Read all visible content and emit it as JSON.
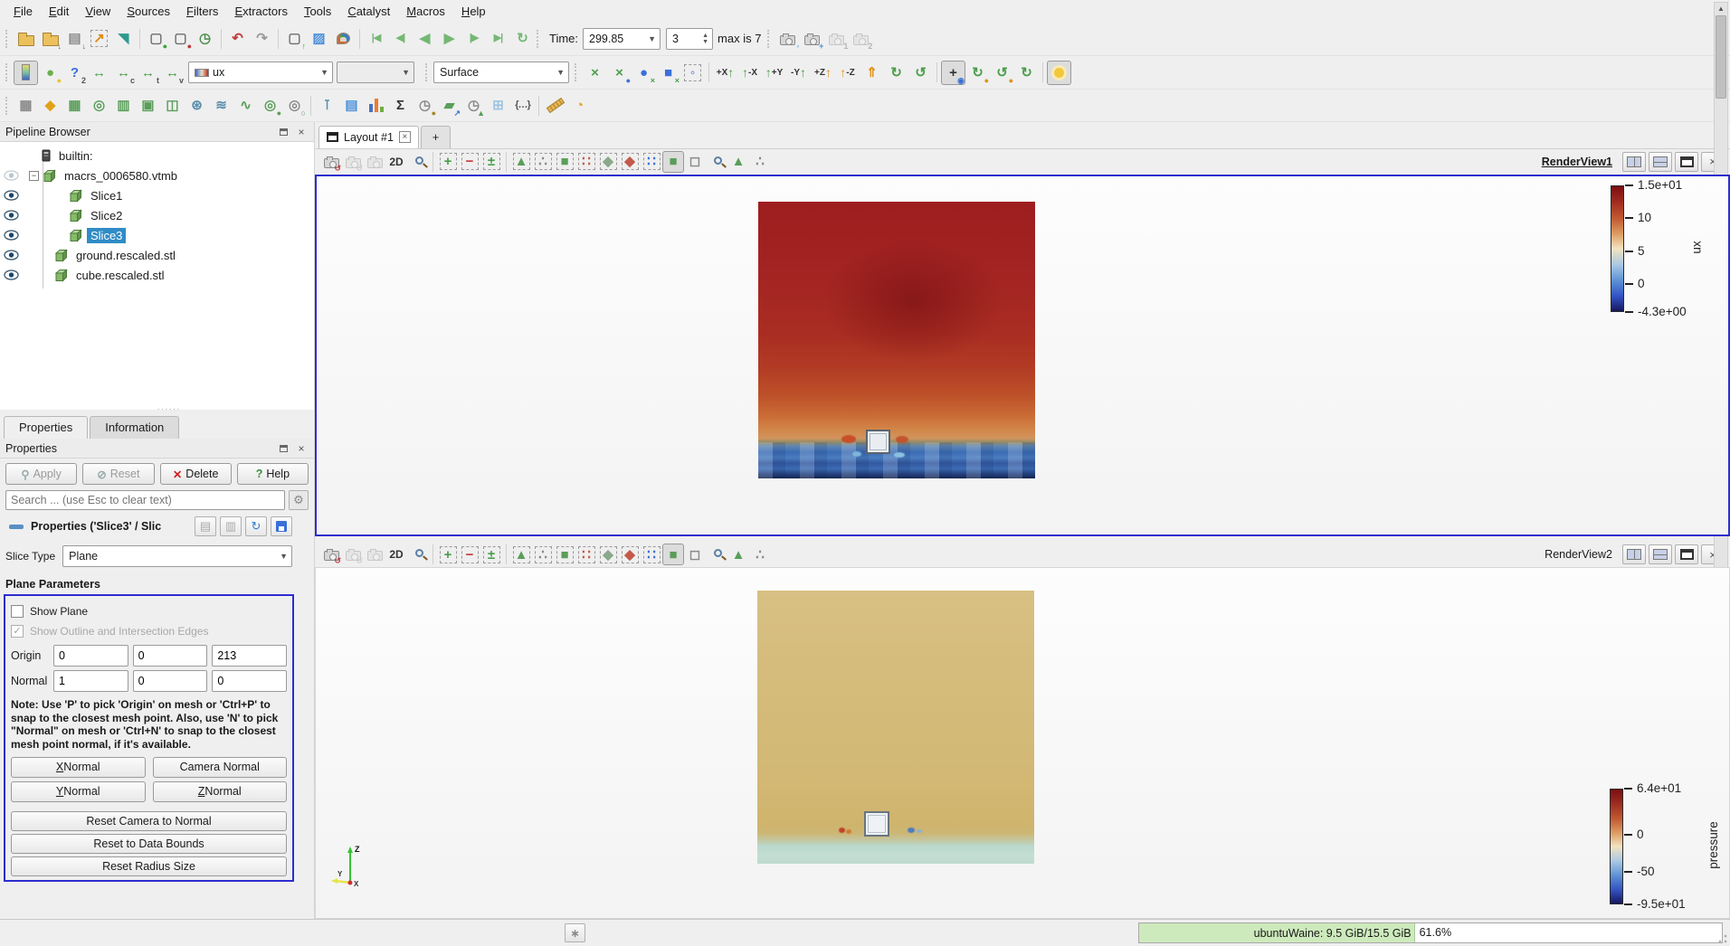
{
  "menu_bar": {
    "items": [
      "File",
      "Edit",
      "View",
      "Sources",
      "Filters",
      "Extractors",
      "Tools",
      "Catalyst",
      "Macros",
      "Help"
    ]
  },
  "toolbar_main": {
    "icons": [
      {
        "n": "open-file-icon",
        "k": "folder"
      },
      {
        "n": "save-data-icon",
        "k": "folder",
        "b": "↓",
        "bc": "#2e8b2e"
      },
      {
        "n": "save-state-icon",
        "g": "▤",
        "c": "#8a8a8a",
        "b": "↓",
        "bc": "#2e8b2e"
      },
      {
        "n": "auto-apply-icon",
        "g": "↗",
        "c": "#e08a1a",
        "f": 1
      },
      {
        "n": "test-tube-icon",
        "g": "◥",
        "c": "#2e9b8f"
      },
      {
        "sep": 1
      },
      {
        "n": "server-connect-icon",
        "g": "▢",
        "c": "#707070",
        "b": "●",
        "bc": "#3aa63a"
      },
      {
        "n": "server-disconnect-icon",
        "g": "▢",
        "c": "#707070",
        "b": "●",
        "bc": "#c23a3a"
      },
      {
        "n": "reset-session-icon",
        "g": "◷",
        "c": "#4a8f4a"
      },
      {
        "sep": 1
      },
      {
        "n": "undo-icon",
        "g": "↶",
        "c": "#c23a3a"
      },
      {
        "n": "redo-icon",
        "g": "↷",
        "c": "#9a9a9a"
      },
      {
        "sep": 1
      },
      {
        "n": "server-upload-icon",
        "g": "▢",
        "c": "#707070",
        "b": "↑",
        "bc": "#3aa63a"
      },
      {
        "n": "selection-save-icon",
        "g": "▨",
        "c": "#4a90d9"
      },
      {
        "n": "color-palette-icon",
        "k": "palette"
      },
      {
        "sep": 1
      },
      {
        "n": "first-frame-icon",
        "g": "|◀",
        "sm": 1,
        "c": "#74b874"
      },
      {
        "n": "previous-frame-icon",
        "g": "◀|",
        "sm": 1,
        "c": "#74b874"
      },
      {
        "n": "play-reverse-icon",
        "g": "◀",
        "c": "#74b874"
      },
      {
        "n": "play-icon",
        "g": "▶",
        "c": "#74b874"
      },
      {
        "n": "next-frame-icon",
        "g": "|▶",
        "sm": 1,
        "c": "#74b874"
      },
      {
        "n": "last-frame-icon",
        "g": "▶|",
        "sm": 1,
        "c": "#74b874"
      },
      {
        "n": "loop-icon",
        "g": "↻",
        "c": "#74b874"
      }
    ],
    "time_label": "Time:",
    "time_value": "299.85",
    "frame_value": "3",
    "max_label": "max is 7",
    "camera_icons": [
      {
        "n": "camera-zoom-icon",
        "k": "cam",
        "b": "◦",
        "bc": "#4a90d9"
      },
      {
        "n": "camera-add-icon",
        "k": "cam",
        "b": "+",
        "bc": "#4a90d9"
      },
      {
        "n": "camera-bookmark1-icon",
        "k": "cam",
        "b": "1",
        "bc": "#555",
        "st": "d"
      },
      {
        "n": "camera-bookmark2-icon",
        "k": "cam",
        "b": "2",
        "bc": "#555",
        "st": "d"
      }
    ]
  },
  "toolbar_variable": {
    "icons": [
      {
        "n": "color-legend-toggle-icon",
        "k": "grad",
        "st": "p"
      },
      {
        "n": "edit-colormap-icon",
        "g": "●",
        "c": "#6ab04c",
        "b": "●",
        "bc": "#e8c13a"
      },
      {
        "n": "choose-preset-icon",
        "g": "?",
        "c": "#3a6fd9",
        "b": "2",
        "bc": "#555"
      },
      {
        "n": "rescale-data-range-icon",
        "g": "↔",
        "c": "#4a9e4a"
      },
      {
        "n": "rescale-custom-range-icon",
        "g": "↔",
        "c": "#4a9e4a",
        "b": "c",
        "bc": "#555"
      },
      {
        "n": "rescale-temporal-icon",
        "g": "↔",
        "c": "#4a9e4a",
        "b": "t",
        "bc": "#555"
      },
      {
        "n": "rescale-visible-icon",
        "g": "↔",
        "c": "#4a9e4a",
        "b": "v",
        "bc": "#555"
      }
    ],
    "array_selected": "ux",
    "component_selected": "",
    "representation_selected": "Surface",
    "camera_icons": [
      {
        "n": "reset-camera-icon",
        "g": "×",
        "c": "#4a9e4a"
      },
      {
        "n": "zoom-to-data-icon",
        "g": "×",
        "c": "#4a9e4a",
        "b": "●",
        "bc": "#3a6fd9"
      },
      {
        "n": "reset-camera-closest-icon",
        "g": "●",
        "c": "#3a6fd9",
        "b": "×",
        "bc": "#4a9e4a"
      },
      {
        "n": "zoom-closest-icon",
        "g": "■",
        "c": "#3a6fd9",
        "b": "×",
        "bc": "#4a9e4a"
      },
      {
        "n": "zoom-to-box-icon",
        "g": "◦",
        "c": "#3a6fd9",
        "f": 1
      },
      {
        "sep": 1
      },
      {
        "n": "view-plus-x-icon",
        "t": "+X",
        "g": "↑",
        "c": "#4a9e4a",
        "ord": "tg"
      },
      {
        "n": "view-minus-x-icon",
        "t": "-X",
        "g": "↑",
        "c": "#4a9e4a",
        "ord": "gt"
      },
      {
        "n": "view-plus-y-icon",
        "t": "+Y",
        "g": "↑",
        "c": "#4a9e4a",
        "ord": "gt"
      },
      {
        "n": "view-minus-y-icon",
        "t": "-Y",
        "g": "↑",
        "c": "#4a9e4a",
        "ord": "tg"
      },
      {
        "n": "view-plus-z-icon",
        "t": "+Z",
        "g": "↑",
        "c": "#e0921a",
        "ord": "tg"
      },
      {
        "n": "view-minus-z-icon",
        "t": "-Z",
        "g": "↑",
        "c": "#e0921a",
        "ord": "gt"
      },
      {
        "n": "isometric-view-icon",
        "g": "⇑",
        "c": "#e0921a"
      },
      {
        "n": "rotate-90-cw-icon",
        "g": "↻",
        "c": "#4a9e4a"
      },
      {
        "n": "rotate-90-ccw-icon",
        "g": "↺",
        "c": "#4a9e4a"
      },
      {
        "sep": 1
      },
      {
        "n": "center-axes-toggle-icon",
        "g": "+",
        "c": "#333",
        "b": "◉",
        "bc": "#3a6fd9",
        "st": "p"
      },
      {
        "n": "reset-center-icon",
        "g": "↻",
        "c": "#4a9e4a",
        "b": "●",
        "bc": "#e0921a"
      },
      {
        "n": "pick-center-icon",
        "g": "↺",
        "c": "#4a9e4a",
        "b": "●",
        "bc": "#e0921a"
      },
      {
        "n": "show-center-icon",
        "g": "↻",
        "c": "#4a9e4a"
      },
      {
        "sep": 1
      },
      {
        "n": "light-toggle-icon",
        "k": "sun",
        "st": "p"
      }
    ]
  },
  "toolbar_filters": {
    "icons": [
      {
        "n": "calculator-icon",
        "g": "▦",
        "c": "#8a8a8a"
      },
      {
        "n": "slice-icon",
        "g": "◆",
        "c": "#e0a21a"
      },
      {
        "n": "threshold-icon",
        "g": "▦",
        "c": "#5a9e5a"
      },
      {
        "n": "contour-icon",
        "g": "◎",
        "c": "#5a9e5a"
      },
      {
        "n": "clip-icon",
        "g": "▥",
        "c": "#5a9e5a"
      },
      {
        "n": "extract-subset-icon",
        "g": "▣",
        "c": "#5a9e5a"
      },
      {
        "n": "slice-along-icon",
        "g": "◫",
        "c": "#5a9e5a"
      },
      {
        "n": "glyph-icon",
        "g": "⊛",
        "c": "#5a8fae"
      },
      {
        "n": "stream-tracer-icon",
        "g": "≋",
        "c": "#5a8fae"
      },
      {
        "n": "warp-icon",
        "g": "∿",
        "c": "#5a9e5a"
      },
      {
        "n": "group-datasets-icon",
        "g": "◎",
        "c": "#5a9e5a",
        "b": "●",
        "bc": "#5a9e5a"
      },
      {
        "n": "extract-block-icon",
        "g": "◎",
        "c": "#8a8a8a",
        "b": "○",
        "bc": "#5a9e5a"
      },
      {
        "sep": 1
      },
      {
        "n": "probe-location-icon",
        "g": "⊺",
        "c": "#5a8fae"
      },
      {
        "n": "extract-selection-icon",
        "g": "▤",
        "c": "#4a90d9"
      },
      {
        "n": "histogram-icon",
        "k": "bars"
      },
      {
        "n": "integrate-variables-icon",
        "g": "Σ",
        "c": "#333"
      },
      {
        "n": "plot-over-time-icon",
        "g": "◷",
        "c": "#8a8a8a",
        "b": "●",
        "bc": "#a8862a"
      },
      {
        "n": "plot-over-line-icon",
        "g": "▰",
        "c": "#5a9e5a",
        "b": "↗",
        "bc": "#3a6fd9"
      },
      {
        "n": "plot-selection-over-time-icon",
        "g": "◷",
        "c": "#8a8a8a",
        "b": "▲",
        "bc": "#5a9e5a"
      },
      {
        "n": "glyph-cube-icon",
        "g": "⊞",
        "c": "#9ec4e0"
      },
      {
        "n": "programmable-filter-icon",
        "g": "{…}",
        "sm": 1,
        "c": "#555"
      },
      {
        "sep": 1
      },
      {
        "n": "ruler-icon",
        "k": "ruler"
      },
      {
        "n": "protractor-icon",
        "g": "◔",
        "c": "#e0a21a"
      }
    ]
  },
  "pipeline_browser": {
    "title": "Pipeline Browser",
    "items": [
      {
        "label": "builtin:",
        "icon": "server",
        "eye": "none",
        "ind": 22
      },
      {
        "label": "macrs_0006580.vtmb",
        "icon": "cube",
        "eye": "faded",
        "ind": 8,
        "expander": "−"
      },
      {
        "label": "Slice1",
        "icon": "cube",
        "eye": "on",
        "ind": 52
      },
      {
        "label": "Slice2",
        "icon": "cube",
        "eye": "on",
        "ind": 52
      },
      {
        "label": "Slice3",
        "icon": "cube",
        "eye": "on",
        "ind": 52,
        "selected": true
      },
      {
        "label": "ground.rescaled.stl",
        "icon": "cube",
        "eye": "on",
        "ind": 36
      },
      {
        "label": "cube.rescaled.stl",
        "icon": "cube",
        "eye": "on",
        "ind": 36
      }
    ]
  },
  "panel_tabs": {
    "tabs": [
      "Properties",
      "Information"
    ],
    "active": 0
  },
  "properties_panel": {
    "dock_title": "Properties",
    "apply_label": "Apply",
    "reset_label": "Reset",
    "delete_label": "Delete",
    "help_label": "Help",
    "search_placeholder": "Search ... (use Esc to clear text)",
    "group_header": "Properties ('Slice3' / Slic",
    "slice_type_label": "Slice Type",
    "slice_type_value": "Plane",
    "section_header": "Plane Parameters",
    "show_plane_label": "Show Plane",
    "show_plane_checked": false,
    "show_outline_label": "Show Outline and Intersection Edges",
    "show_outline_checked": true,
    "origin_label": "Origin",
    "origin_values": [
      "0",
      "0",
      "213"
    ],
    "normal_label": "Normal",
    "normal_values": [
      "1",
      "0",
      "0"
    ],
    "note": "Note: Use 'P' to pick 'Origin' on mesh or 'Ctrl+P' to snap to the closest mesh point. Also, use 'N' to pick \"Normal\" on mesh or 'Ctrl+N' to snap to the closest mesh point normal, if it's available.",
    "normal_buttons": [
      {
        "label": "X Normal",
        "u": true
      },
      {
        "label": "Camera Normal",
        "u": false
      },
      {
        "label": "Y Normal",
        "u": true
      },
      {
        "label": "Z Normal",
        "u": true
      }
    ],
    "reset_buttons": [
      "Reset Camera to Normal",
      "Reset to Data Bounds",
      "Reset Radius Size"
    ]
  },
  "layout_tabs": {
    "tab1": "Layout #1",
    "add": "+"
  },
  "view_toolbar": {
    "icons": [
      {
        "n": "capture-screenshot-icon",
        "k": "cam",
        "b": "↺",
        "bc": "#c23a3a"
      },
      {
        "n": "capture-all-views-icon",
        "k": "cam",
        "b": "↺",
        "bc": "#9a9a9a",
        "st": "d"
      },
      {
        "n": "capture-view-icon",
        "k": "cam",
        "st": "d"
      },
      {
        "n": "toggle-2d-mode-button",
        "t2": "2D"
      },
      {
        "n": "zoom-to-box-icon",
        "k": "mag"
      },
      {
        "sep": 1
      },
      {
        "n": "add-selection-icon",
        "g": "+",
        "c": "#4a9e4a",
        "f": 1
      },
      {
        "n": "subtract-selection-icon",
        "g": "−",
        "c": "#c23a3a",
        "f": 1
      },
      {
        "n": "toggle-selection-icon",
        "g": "±",
        "c": "#4a9e4a",
        "f": 1
      },
      {
        "sep": 1
      },
      {
        "n": "select-cells-on-icon",
        "g": "▲",
        "c": "#5a9e5a",
        "f": 1
      },
      {
        "n": "select-points-on-icon",
        "g": "∴",
        "c": "#888",
        "f": 1
      },
      {
        "n": "select-cells-through-icon",
        "g": "■",
        "c": "#5a9e5a",
        "f": 1
      },
      {
        "n": "select-points-through-icon",
        "g": "∷",
        "c": "#c25a4a",
        "f": 1
      },
      {
        "n": "select-cells-polygon-icon",
        "g": "◆",
        "c": "#8aa88a",
        "f": 1
      },
      {
        "n": "select-points-polygon-icon",
        "g": "◆",
        "c": "#c25a4a",
        "f": 1
      },
      {
        "n": "select-blocks-icon",
        "g": "∷",
        "c": "#3a6fd9",
        "f": 1
      },
      {
        "n": "interactive-select-cells-icon",
        "g": "■",
        "c": "#5a9e5a",
        "st": "p"
      },
      {
        "n": "interactive-select-blocks-icon",
        "g": "◻",
        "c": "#8a8a8a"
      },
      {
        "n": "hover-points-icon",
        "k": "mag"
      },
      {
        "n": "hover-cells-icon",
        "g": "▲",
        "c": "#5a9e5a"
      },
      {
        "n": "pick-points-icon",
        "g": "∴",
        "c": "#888"
      }
    ],
    "window_buttons": [
      "split-horizontal-button",
      "split-vertical-button",
      "maximize-button",
      "close-view-button"
    ]
  },
  "renderview1": {
    "name": "RenderView1",
    "active": true,
    "colorbar": {
      "title": "ux",
      "ticks": [
        "1.5e+01",
        "10",
        "5",
        "0",
        "-4.3e+00"
      ],
      "pos": [
        0,
        0.26,
        0.52,
        0.78,
        1
      ],
      "colormap_top": "#7a0f12",
      "colormap_mid": "#f2e3c0",
      "colormap_bottom": "#16175e"
    }
  },
  "renderview2": {
    "name": "RenderView2",
    "active": false,
    "colorbar": {
      "title": "pressure",
      "ticks": [
        "6.4e+01",
        "0",
        "-50",
        "-9.5e+01"
      ],
      "pos": [
        0,
        0.4,
        0.72,
        1
      ],
      "colormap_top": "#7a0f12",
      "colormap_mid": "#f2e3c0",
      "colormap_bottom": "#16175e"
    },
    "axes_labels": [
      "Z",
      "Y",
      "X"
    ]
  },
  "status_bar": {
    "memory_text": "ubuntuWaine: 9.5 GiB/15.5 GiB",
    "percent_text": "61.6%"
  }
}
